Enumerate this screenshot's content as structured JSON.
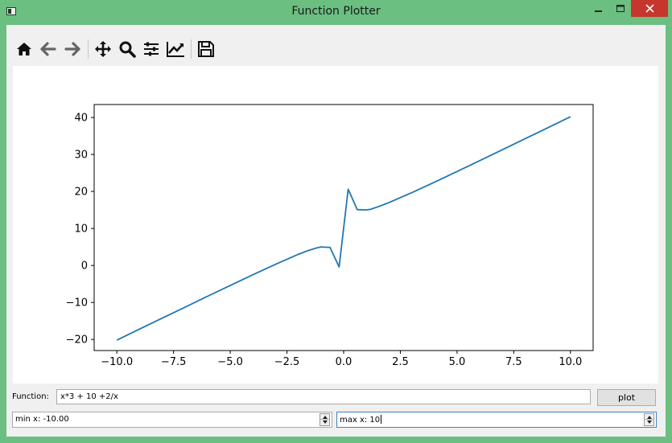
{
  "window": {
    "title": "Function Plotter"
  },
  "toolbar": {
    "items": [
      {
        "name": "home-icon"
      },
      {
        "name": "back-icon"
      },
      {
        "name": "forward-icon"
      },
      {
        "name": "pan-icon"
      },
      {
        "name": "zoom-icon"
      },
      {
        "name": "subplots-icon"
      },
      {
        "name": "edit-axis-icon"
      },
      {
        "name": "save-icon"
      }
    ]
  },
  "controls": {
    "function_label": "Function:",
    "function_value": "x*3 + 10 +2/x",
    "plot_label": "plot",
    "min_x_text": "min x: -10.00",
    "max_x_text": "max x: 10"
  },
  "chart_data": {
    "type": "line",
    "title": "",
    "xlabel": "",
    "ylabel": "",
    "xlim": [
      -11.0,
      11.0
    ],
    "ylim": [
      -23.0,
      43.5
    ],
    "xticks": [
      "−10.0",
      "−7.5",
      "−5.0",
      "−2.5",
      "0.0",
      "2.5",
      "5.0",
      "7.5",
      "10.0"
    ],
    "xtick_values": [
      -10,
      -7.5,
      -5,
      -2.5,
      0,
      2.5,
      5,
      7.5,
      10
    ],
    "yticks": [
      "−20",
      "−10",
      "0",
      "10",
      "20",
      "30",
      "40"
    ],
    "ytick_values": [
      -20,
      -10,
      0,
      10,
      20,
      30,
      40
    ],
    "line_color": "#1f77b4",
    "series": [
      {
        "x": [
          -10,
          -9,
          -8,
          -7,
          -6,
          -5,
          -4,
          -3,
          -2,
          -1.6,
          -1.2,
          -1,
          -0.6,
          -0.2,
          0.2,
          0.6,
          1,
          1.2,
          1.6,
          2,
          3,
          4,
          5,
          6,
          7,
          8,
          9,
          10
        ],
        "y": [
          -20.2,
          -17.2,
          -14.25,
          -11.3,
          -8.33,
          -5.4,
          -2.5,
          0.33,
          3.0,
          3.95,
          4.72,
          5.0,
          4.87,
          -0.4,
          20.6,
          15.1,
          15.0,
          15.2,
          16.05,
          17.0,
          19.67,
          22.5,
          25.4,
          28.33,
          31.29,
          34.25,
          37.22,
          40.2
        ]
      }
    ]
  }
}
